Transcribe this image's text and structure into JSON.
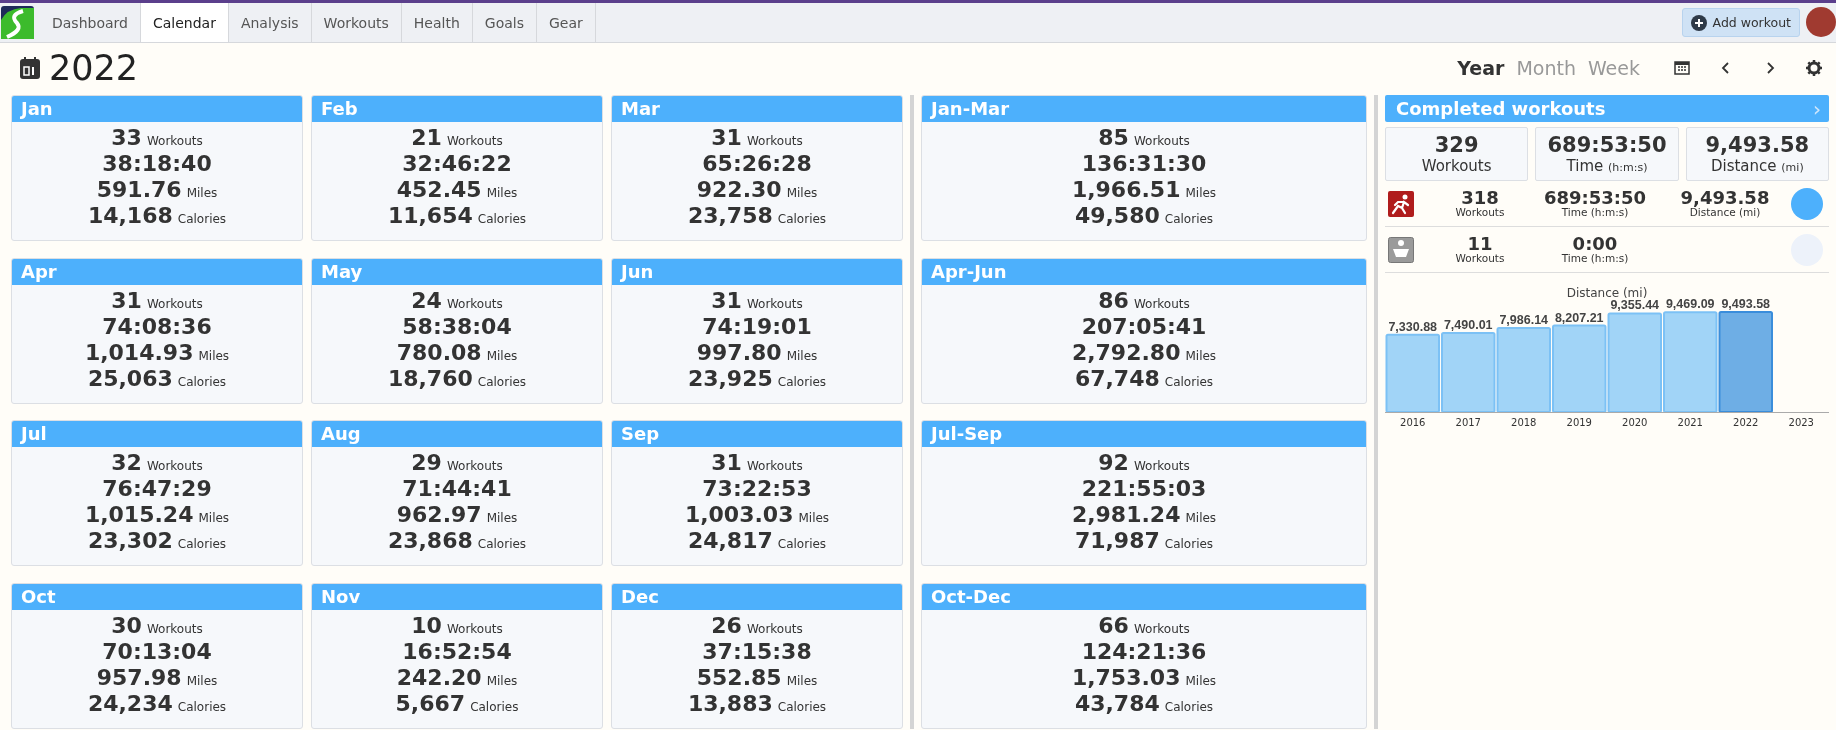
{
  "nav": {
    "tabs": [
      {
        "label": "Dashboard",
        "selected": false
      },
      {
        "label": "Calendar",
        "selected": true
      },
      {
        "label": "Analysis",
        "selected": false
      },
      {
        "label": "Workouts",
        "selected": false
      },
      {
        "label": "Health",
        "selected": false
      },
      {
        "label": "Goals",
        "selected": false
      },
      {
        "label": "Gear",
        "selected": false
      }
    ],
    "add_button": "Add workout"
  },
  "title": "2022",
  "views": [
    {
      "label": "Year",
      "selected": true
    },
    {
      "label": "Month",
      "selected": false
    },
    {
      "label": "Week",
      "selected": false
    }
  ],
  "months": [
    {
      "name": "Jan",
      "workouts": "33",
      "workouts_label": "Workouts",
      "time": "38:18:40",
      "miles": "591.76",
      "miles_label": "Miles",
      "calories": "14,168",
      "calories_label": "Calories"
    },
    {
      "name": "Feb",
      "workouts": "21",
      "workouts_label": "Workouts",
      "time": "32:46:22",
      "miles": "452.45",
      "miles_label": "Miles",
      "calories": "11,654",
      "calories_label": "Calories"
    },
    {
      "name": "Mar",
      "workouts": "31",
      "workouts_label": "Workouts",
      "time": "65:26:28",
      "miles": "922.30",
      "miles_label": "Miles",
      "calories": "23,758",
      "calories_label": "Calories"
    },
    {
      "name": "Apr",
      "workouts": "31",
      "workouts_label": "Workouts",
      "time": "74:08:36",
      "miles": "1,014.93",
      "miles_label": "Miles",
      "calories": "25,063",
      "calories_label": "Calories"
    },
    {
      "name": "May",
      "workouts": "24",
      "workouts_label": "Workouts",
      "time": "58:38:04",
      "miles": "780.08",
      "miles_label": "Miles",
      "calories": "18,760",
      "calories_label": "Calories"
    },
    {
      "name": "Jun",
      "workouts": "31",
      "workouts_label": "Workouts",
      "time": "74:19:01",
      "miles": "997.80",
      "miles_label": "Miles",
      "calories": "23,925",
      "calories_label": "Calories"
    },
    {
      "name": "Jul",
      "workouts": "32",
      "workouts_label": "Workouts",
      "time": "76:47:29",
      "miles": "1,015.24",
      "miles_label": "Miles",
      "calories": "23,302",
      "calories_label": "Calories"
    },
    {
      "name": "Aug",
      "workouts": "29",
      "workouts_label": "Workouts",
      "time": "71:44:41",
      "miles": "962.97",
      "miles_label": "Miles",
      "calories": "23,868",
      "calories_label": "Calories"
    },
    {
      "name": "Sep",
      "workouts": "31",
      "workouts_label": "Workouts",
      "time": "73:22:53",
      "miles": "1,003.03",
      "miles_label": "Miles",
      "calories": "24,817",
      "calories_label": "Calories"
    },
    {
      "name": "Oct",
      "workouts": "30",
      "workouts_label": "Workouts",
      "time": "70:13:04",
      "miles": "957.98",
      "miles_label": "Miles",
      "calories": "24,234",
      "calories_label": "Calories"
    },
    {
      "name": "Nov",
      "workouts": "10",
      "workouts_label": "Workouts",
      "time": "16:52:54",
      "miles": "242.20",
      "miles_label": "Miles",
      "calories": "5,667",
      "calories_label": "Calories"
    },
    {
      "name": "Dec",
      "workouts": "26",
      "workouts_label": "Workouts",
      "time": "37:15:38",
      "miles": "552.85",
      "miles_label": "Miles",
      "calories": "13,883",
      "calories_label": "Calories"
    }
  ],
  "quarters": [
    {
      "name": "Jan-Mar",
      "workouts": "85",
      "workouts_label": "Workouts",
      "time": "136:31:30",
      "miles": "1,966.51",
      "miles_label": "Miles",
      "calories": "49,580",
      "calories_label": "Calories"
    },
    {
      "name": "Apr-Jun",
      "workouts": "86",
      "workouts_label": "Workouts",
      "time": "207:05:41",
      "miles": "2,792.80",
      "miles_label": "Miles",
      "calories": "67,748",
      "calories_label": "Calories"
    },
    {
      "name": "Jul-Sep",
      "workouts": "92",
      "workouts_label": "Workouts",
      "time": "221:55:03",
      "miles": "2,981.24",
      "miles_label": "Miles",
      "calories": "71,987",
      "calories_label": "Calories"
    },
    {
      "name": "Oct-Dec",
      "workouts": "66",
      "workouts_label": "Workouts",
      "time": "124:21:36",
      "miles": "1,753.03",
      "miles_label": "Miles",
      "calories": "43,784",
      "calories_label": "Calories"
    }
  ],
  "completed": {
    "title": "Completed workouts",
    "chevron": "›",
    "totals": [
      {
        "value": "329",
        "label": "Workouts"
      },
      {
        "value": "689:53:50",
        "label": "Time",
        "unit": "(h:m:s)"
      },
      {
        "value": "9,493.58",
        "label": "Distance",
        "unit": "(mi)"
      }
    ],
    "activities": [
      {
        "kind": "run",
        "workouts": "318",
        "workouts_label": "Workouts",
        "time": "689:53:50",
        "time_label": "Time (h:m:s)",
        "distance": "9,493.58",
        "distance_label": "Distance (mi)",
        "color": "#4db0fc"
      },
      {
        "kind": "other",
        "workouts": "11",
        "workouts_label": "Workouts",
        "time": "0:00",
        "time_label": "Time (h:m:s)",
        "color": "#edf2fa"
      }
    ],
    "chart_data": {
      "type": "bar",
      "title": "Distance (mi)",
      "categories": [
        "2016",
        "2017",
        "2018",
        "2019",
        "2020",
        "2021",
        "2022",
        "2023"
      ],
      "series": [
        {
          "color": "#a1d4f7",
          "values": [
            7330.88,
            7490.01,
            7986.14,
            8207.21,
            9355.44,
            9469.09,
            null,
            null
          ],
          "value_labels": [
            "7,330.88",
            "7,490.01",
            "7,986.14",
            "8,207.21",
            "9,355.44",
            "9,469.09",
            null,
            null
          ]
        },
        {
          "color": "#6eaee5",
          "values": [
            null,
            null,
            null,
            null,
            null,
            null,
            9493.58,
            null
          ],
          "value_labels": [
            null,
            null,
            null,
            null,
            null,
            null,
            "9,493.58",
            null
          ]
        }
      ],
      "stacked": true
    }
  }
}
